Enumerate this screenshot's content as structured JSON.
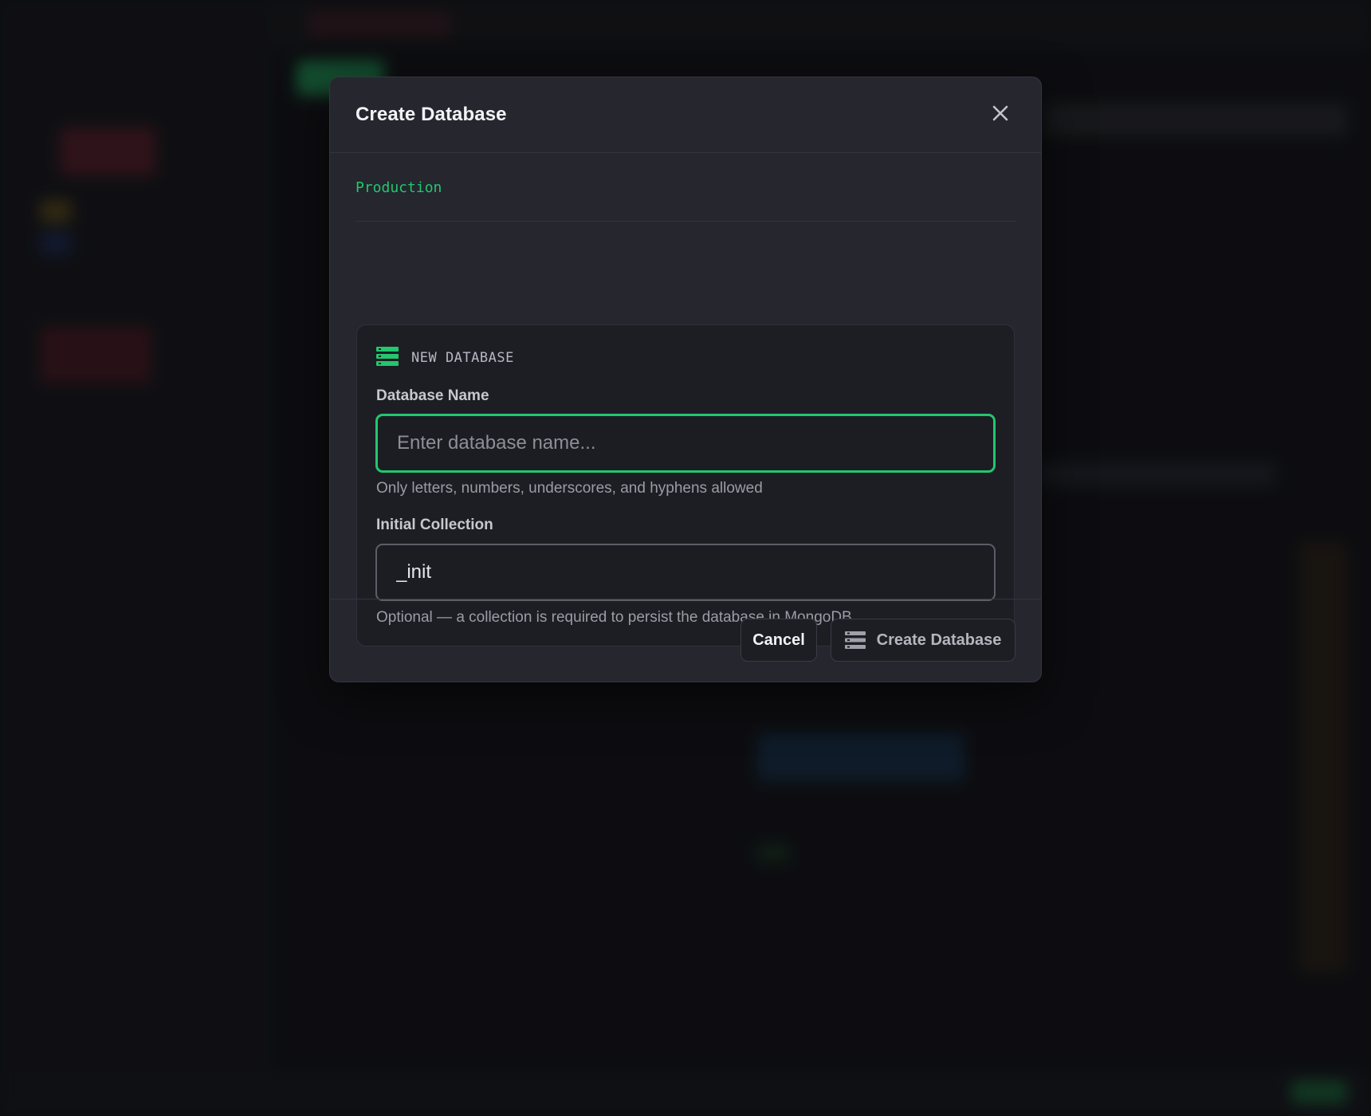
{
  "modal": {
    "title": "Create Database",
    "connection_name": "Production",
    "card_heading": "NEW DATABASE",
    "fields": {
      "database_name": {
        "label": "Database Name",
        "value": "",
        "placeholder": "Enter database name...",
        "help": "Only letters, numbers, underscores, and hyphens allowed"
      },
      "initial_collection": {
        "label": "Initial Collection",
        "value": "_init",
        "placeholder": "",
        "help": "Optional — a collection is required to persist the database in MongoDB"
      }
    },
    "buttons": {
      "cancel": "Cancel",
      "create": "Create Database"
    },
    "icons": {
      "close": "close-icon",
      "card": "database-icon",
      "create": "database-icon"
    }
  },
  "colors": {
    "accent": "#22c76e",
    "modal_bg": "#25262e",
    "card_bg": "#1d1e24",
    "text_primary": "#f2f3f5",
    "text_muted": "#9a9da6"
  }
}
